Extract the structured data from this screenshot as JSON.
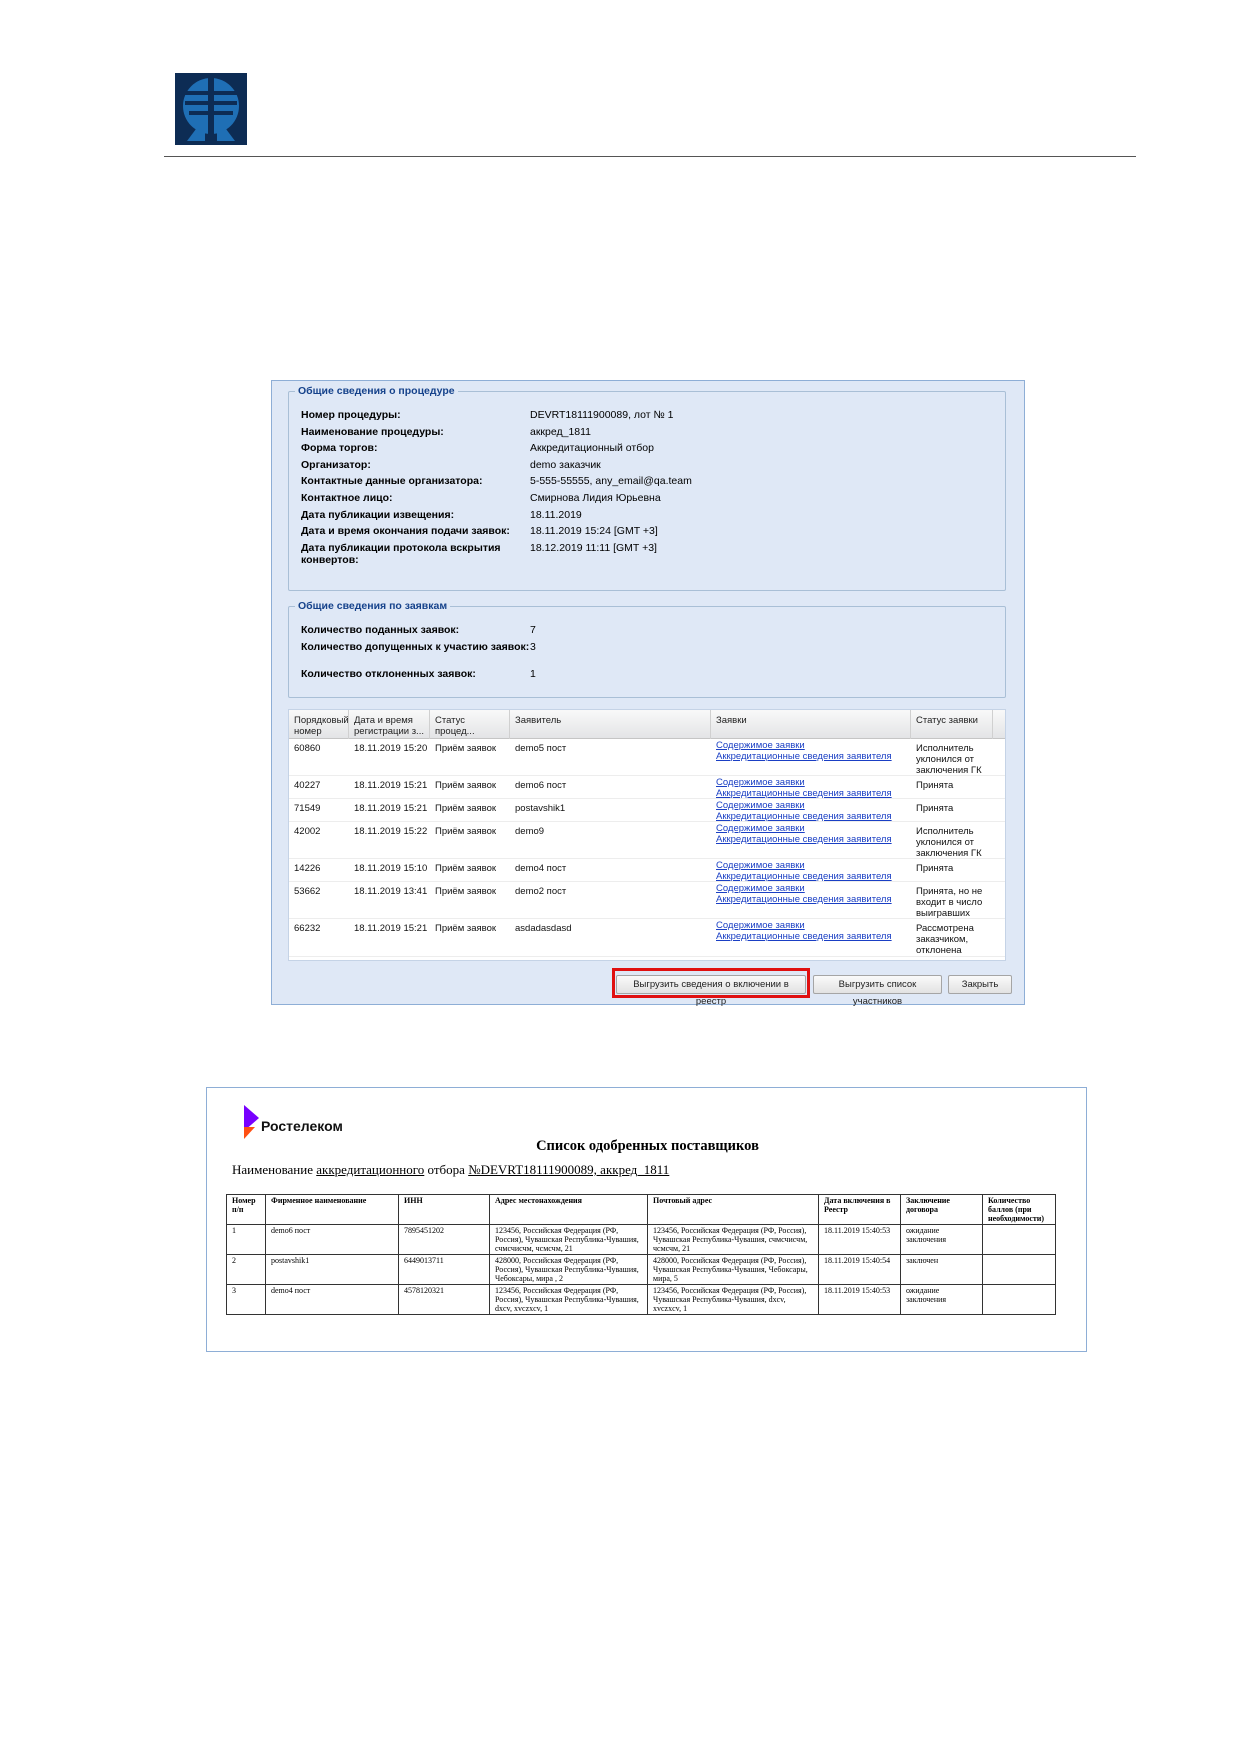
{
  "procedure_info": {
    "legend": "Общие сведения о процедуре",
    "fields": [
      {
        "label": "Номер процедуры:",
        "value": "DEVRT18111900089, лот № 1"
      },
      {
        "label": "Наименование процедуры:",
        "value": "аккред_1811"
      },
      {
        "label": "Форма торгов:",
        "value": "Аккредитационный отбор"
      },
      {
        "label": "Организатор:",
        "value": "demo заказчик"
      },
      {
        "label": "Контактные данные организатора:",
        "value": "5-555-55555, any_email@qa.team"
      },
      {
        "label": "Контактное лицо:",
        "value": "Смирнова Лидия Юрьевна"
      },
      {
        "label": "Дата публикации извещения:",
        "value": "18.11.2019"
      },
      {
        "label": "Дата и время окончания подачи заявок:",
        "value": "18.11.2019 15:24 [GMT +3]"
      },
      {
        "label": "Дата публикации протокола вскрытия конвертов:",
        "value": "18.12.2019 11:11 [GMT +3]"
      }
    ]
  },
  "applications_info": {
    "legend": "Общие сведения по заявкам",
    "fields": [
      {
        "label": "Количество поданных заявок:",
        "value": "7"
      },
      {
        "label": "Количество допущенных к участию заявок:",
        "value": "3"
      },
      {
        "label": "Количество отклоненных заявок:",
        "value": "1"
      }
    ]
  },
  "grid": {
    "columns": [
      "Порядковый номер",
      "Дата и время регистрации з...",
      "Статус процед...",
      "Заявитель",
      "Заявки",
      "Статус заявки"
    ],
    "link_content": "Содержимое заявки",
    "link_accreditation": "Аккредитационные сведения заявителя",
    "rows": [
      {
        "num": "60860",
        "date": "18.11.2019 15:20",
        "status": "Приём заявок",
        "applicant": "demo5 пост",
        "app_status": "Исполнитель уклонился от заключения ГК"
      },
      {
        "num": "40227",
        "date": "18.11.2019 15:21",
        "status": "Приём заявок",
        "applicant": "demo6 пост",
        "app_status": "Принята"
      },
      {
        "num": "71549",
        "date": "18.11.2019 15:21",
        "status": "Приём заявок",
        "applicant": "postavshik1",
        "app_status": "Принята"
      },
      {
        "num": "42002",
        "date": "18.11.2019 15:22",
        "status": "Приём заявок",
        "applicant": "demo9",
        "app_status": "Исполнитель уклонился от заключения ГК"
      },
      {
        "num": "14226",
        "date": "18.11.2019 15:10",
        "status": "Приём заявок",
        "applicant": "demo4 пост",
        "app_status": "Принята"
      },
      {
        "num": "53662",
        "date": "18.11.2019 13:41",
        "status": "Приём заявок",
        "applicant": "demo2 пост",
        "app_status": "Принята, но не входит в число выигравших"
      },
      {
        "num": "66232",
        "date": "18.11.2019 15:21",
        "status": "Приём заявок",
        "applicant": "asdadasdasd",
        "app_status": "Рассмотрена заказчиком, отклонена"
      }
    ]
  },
  "buttons": {
    "export_registry": "Выгрузить сведения о включении в реестр",
    "export_participants": "Выгрузить список участников",
    "close": "Закрыть"
  },
  "report": {
    "brand": "Ростелеком",
    "title": "Список одобренных поставщиков",
    "subtitle_prefix": "Наименование",
    "subtitle_word": "аккредитационного",
    "subtitle_mid": "отбора",
    "subtitle_ref": "№DEVRT18111900089, аккред_1811",
    "columns": [
      "Номер п/п",
      "Фирменное наименование",
      "ИНН",
      "Адрес местонахождения",
      "Почтовый адрес",
      "Дата включения в Реестр",
      "Заключение договора",
      "Количество баллов (при необходимости)"
    ],
    "rows": [
      {
        "n": "1",
        "name": "demo6 пост",
        "inn": "7895451202",
        "addr": "123456, Российская Федерация (РФ, Россия), Чувашская Республика-Чувашия, счмсчисчм, чсмсчм, 21",
        "post": "123456, Российская Федерация (РФ, Россия), Чувашская Республика-Чувашия, счмсчисчм, чсмсчм, 21",
        "date": "18.11.2019 15:40:53",
        "contract": "ожидание заключения",
        "score": ""
      },
      {
        "n": "2",
        "name": "postavshik1",
        "inn": "6449013711",
        "addr": "428000, Российская Федерация (РФ, Россия), Чувашская Республика-Чувашия, Чебоксары, мира , 2",
        "post": "428000, Российская Федерация (РФ, Россия), Чувашская Республика-Чувашия, Чебоксары, мира, 5",
        "date": "18.11.2019 15:40:54",
        "contract": "заключен",
        "score": ""
      },
      {
        "n": "3",
        "name": "demo4 пост",
        "inn": "4578120321",
        "addr": "123456, Российская Федерация (РФ, Россия), Чувашская Республика-Чувашия, dxcv, xvczxcv, 1",
        "post": "123456, Российская Федерация (РФ, Россия), Чувашская Республика-Чувашия, dxcv, xvczxcv, 1",
        "date": "18.11.2019 15:40:53",
        "contract": "ожидание заключения",
        "score": ""
      }
    ]
  },
  "colors": {
    "logo_blue": "#1f6fb5",
    "logo_dark": "#0d2c54",
    "rt_purple": "#7800ff",
    "rt_orange": "#ff4f12",
    "highlight": "#e01010",
    "link": "#1a3fc4"
  }
}
